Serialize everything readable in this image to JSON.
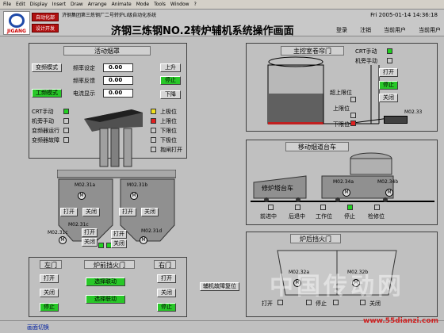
{
  "menu": [
    "File",
    "Edit",
    "Display",
    "Insert",
    "Draw",
    "Arrange",
    "Animate",
    "Mode",
    "Tools",
    "Window",
    "?"
  ],
  "header": {
    "logo_text": "JIGANG",
    "btn_auto": "自动化部",
    "btn_design": "设计开发",
    "subtitle": "济钢集团第三炼钢厂二号转炉LI级自动化系统",
    "title": "济钢三炼钢NO.2转炉辅机系统操作画面",
    "datetime": "Fri 2005-01-14 14:36:18",
    "links": [
      "登录",
      "注销",
      "当前用户",
      "当前用户"
    ]
  },
  "hood": {
    "title": "活动烟罩",
    "mode_vf": "变频模式",
    "mode_pf": "工频模式",
    "freq_set_label": "频率设定",
    "freq_set_val": "0.00",
    "freq_fb_label": "频率反馈",
    "freq_fb_val": "0.00",
    "curr_label": "电流显示",
    "curr_val": "0.00",
    "btn_up": "上升",
    "btn_stop": "停止",
    "btn_down": "下降",
    "left_status": [
      "CRT手动",
      "机旁手动",
      "变频器运行",
      "变频器故障"
    ],
    "right_status": [
      "上极位",
      "上限位",
      "下限位",
      "下极位",
      "抱闸打开"
    ]
  },
  "curtain": {
    "title": "主控室卷帘门",
    "status": [
      "CRT手动",
      "机旁手动"
    ],
    "btn_open": "打开",
    "btn_stop": "停止",
    "btn_close": "关闭",
    "limits": [
      "超上限位",
      "上限位",
      "下限位"
    ],
    "motor": "M02.33"
  },
  "hoppers": {
    "left_motors": [
      "M02.31a",
      "M02.31c"
    ],
    "right_motors": [
      "M02.31b",
      "M02.31d"
    ],
    "btn_open": "打开",
    "btn_close": "关闭"
  },
  "cart": {
    "title": "移动烟道台车",
    "car_label": "修炉塔台车",
    "motors": [
      "M02.34a",
      "M02.34b"
    ],
    "positions": [
      "前进中",
      "后退中",
      "工作位",
      "停止",
      "检修位"
    ]
  },
  "fire_door": {
    "left": "左门",
    "mid": "炉前挡火门",
    "right": "右门",
    "btn_open": "打开",
    "btn_close": "关闭",
    "btn_stop": "停止",
    "sel1": "选择联动",
    "sel2": "选择联动"
  },
  "rear_door": {
    "title": "炉后挡火门",
    "motors": [
      "M02.32a",
      "M02.32b"
    ],
    "controls": [
      "打开",
      "停止",
      "关闭"
    ]
  },
  "fault_reset": "辅机故障复位",
  "bottom_tab": "画面切换",
  "watermark": "中国传动网",
  "watermark_url": "www.55dianzi.com"
}
